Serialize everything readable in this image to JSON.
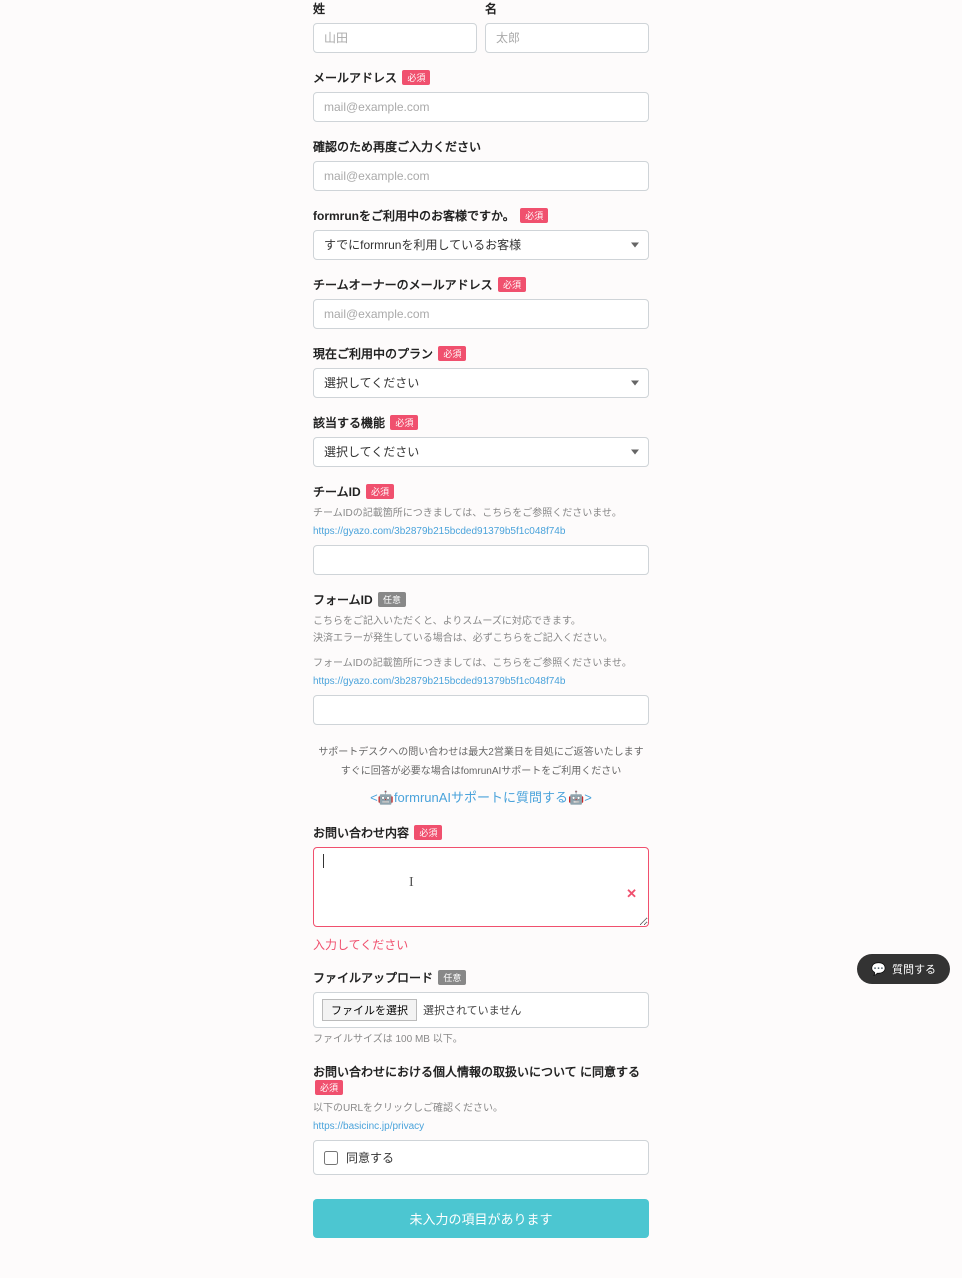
{
  "fields": {
    "last_name": {
      "label": "姓",
      "placeholder": "山田"
    },
    "first_name": {
      "label": "名",
      "placeholder": "太郎"
    },
    "email": {
      "label": "メールアドレス",
      "placeholder": "mail@example.com"
    },
    "email_confirm": {
      "label": "確認のため再度ご入力ください",
      "placeholder": "mail@example.com"
    },
    "customer_status": {
      "label": "formrunをご利用中のお客様ですか。",
      "selected": "すでにformrunを利用しているお客様"
    },
    "owner_email": {
      "label": "チームオーナーのメールアドレス",
      "placeholder": "mail@example.com"
    },
    "plan": {
      "label": "現在ご利用中のプラン",
      "selected": "選択してください"
    },
    "feature": {
      "label": "該当する機能",
      "selected": "選択してください"
    },
    "team_id": {
      "label": "チームID",
      "help": "チームIDの記載箇所につきましては、こちらをご参照くださいませ。",
      "link": "https://gyazo.com/3b2879b215bcded91379b5f1c048f74b"
    },
    "form_id": {
      "label": "フォームID",
      "help1": "こちらをご記入いただくと、よりスムーズに対応できます。",
      "help2": "決済エラーが発生している場合は、必ずこちらをご記入ください。",
      "help3": "フォームIDの記載箇所につきましては、こちらをご参照くださいませ。",
      "link": "https://gyazo.com/3b2879b215bcded91379b5f1c048f74b"
    },
    "inquiry": {
      "label": "お問い合わせ内容",
      "error": "入力してください"
    },
    "file": {
      "label": "ファイルアップロード",
      "btn": "ファイルを選択",
      "status": "選択されていません",
      "note": "ファイルサイズは 100 MB 以下。"
    },
    "privacy": {
      "label": "お問い合わせにおける個人情報の取扱いについて に同意する",
      "help": "以下のURLをクリックしご確認ください。",
      "link": "https://basicinc.jp/privacy",
      "checkbox_label": "同意する"
    }
  },
  "badges": {
    "required": "必須",
    "optional": "任意"
  },
  "support": {
    "line1": "サポートデスクへの問い合わせは最大2営業日を目処にご返答いたします",
    "line2": "すぐに回答が必要な場合はfomrunAIサポートをご利用ください",
    "ai_link": "<🤖formrunAIサポートに質問する🤖>"
  },
  "submit": "未入力の項目があります",
  "chat": "質問する"
}
